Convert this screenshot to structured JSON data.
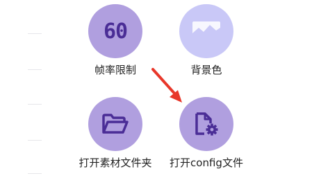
{
  "tiles": [
    {
      "id": "fps-limit",
      "label": "帧率限制",
      "icon": "fps-60-icon",
      "glyph": "60"
    },
    {
      "id": "background-color",
      "label": "背景色",
      "icon": "image-mountain-icon"
    },
    {
      "id": "open-assets-folder",
      "label": "打开素材文件夹",
      "icon": "folder-open-icon"
    },
    {
      "id": "open-config-file",
      "label": "打开config文件",
      "icon": "file-settings-icon"
    }
  ],
  "colors": {
    "tile_dark": "#b09fdf",
    "tile_light": "#c9c8f7",
    "icon_dark": "#4a2d96",
    "icon_light": "#ffffff",
    "arrow": "#e8372a"
  }
}
